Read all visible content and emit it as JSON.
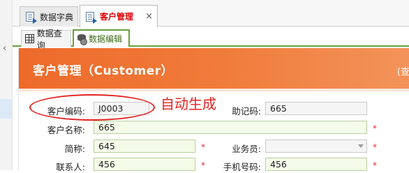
{
  "tabs": [
    {
      "label": "数据字典",
      "active": false
    },
    {
      "label": "客户管理",
      "active": true
    }
  ],
  "close_glyph": "×",
  "left_chevron": "‹",
  "subtabs": [
    {
      "label": "数据查询",
      "active": false
    },
    {
      "label": "数据编辑",
      "active": true
    }
  ],
  "panel": {
    "title": "客户管理（Customer）",
    "right_link": "(查"
  },
  "form": {
    "customer_code": {
      "label": "客户编码:",
      "value": "J0003"
    },
    "mnemonic": {
      "label": "助记码:",
      "value": "665"
    },
    "customer_name": {
      "label": "客户名称:",
      "value": "665"
    },
    "short_name": {
      "label": "简称:",
      "value": "645"
    },
    "salesperson": {
      "label": "业务员:",
      "value": ""
    },
    "contact": {
      "label": "联系人:",
      "value": "456"
    },
    "mobile": {
      "label": "手机号码:",
      "value": "456"
    },
    "required_mark": "*"
  },
  "annotation": {
    "text": "自动生成"
  },
  "colors": {
    "header_orange": "#ee6a2a",
    "active_tab_text": "#dd0000",
    "subtab_green": "#67a03a",
    "annotation_red": "#e32222",
    "input_bg_green": "#f4fbe9"
  }
}
